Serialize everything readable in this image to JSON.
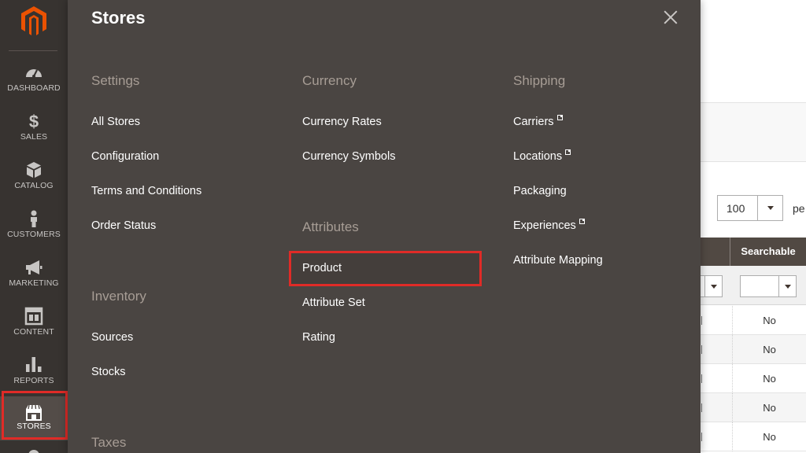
{
  "background": {
    "per_page_value": "100",
    "per_page_label": "pe",
    "grid_header": "Searchable",
    "rows": [
      "No",
      "No",
      "No",
      "No",
      "No"
    ]
  },
  "nav": {
    "items": [
      {
        "label": "DASHBOARD",
        "icon": "dashboard-icon"
      },
      {
        "label": "SALES",
        "icon": "dollar-icon"
      },
      {
        "label": "CATALOG",
        "icon": "cube-icon"
      },
      {
        "label": "CUSTOMERS",
        "icon": "person-icon"
      },
      {
        "label": "MARKETING",
        "icon": "megaphone-icon"
      },
      {
        "label": "CONTENT",
        "icon": "layout-icon"
      },
      {
        "label": "REPORTS",
        "icon": "bar-chart-icon"
      },
      {
        "label": "STORES",
        "icon": "storefront-icon"
      }
    ],
    "active": "STORES"
  },
  "panel": {
    "title": "Stores",
    "sections": {
      "settings": {
        "title": "Settings",
        "links": [
          "All Stores",
          "Configuration",
          "Terms and Conditions",
          "Order Status"
        ]
      },
      "inventory": {
        "title": "Inventory",
        "links": [
          "Sources",
          "Stocks"
        ]
      },
      "taxes": {
        "title": "Taxes"
      },
      "currency": {
        "title": "Currency",
        "links": [
          "Currency Rates",
          "Currency Symbols"
        ]
      },
      "attributes": {
        "title": "Attributes",
        "links": [
          "Product",
          "Attribute Set",
          "Rating"
        ]
      },
      "shipping": {
        "title": "Shipping",
        "links": [
          "Carriers",
          "Locations",
          "Packaging",
          "Experiences",
          "Attribute Mapping"
        ]
      }
    }
  },
  "colors": {
    "nav_bg": "#373330",
    "panel_bg": "#4a4542",
    "highlight": "#e02b27",
    "brand": "#eb5202"
  }
}
